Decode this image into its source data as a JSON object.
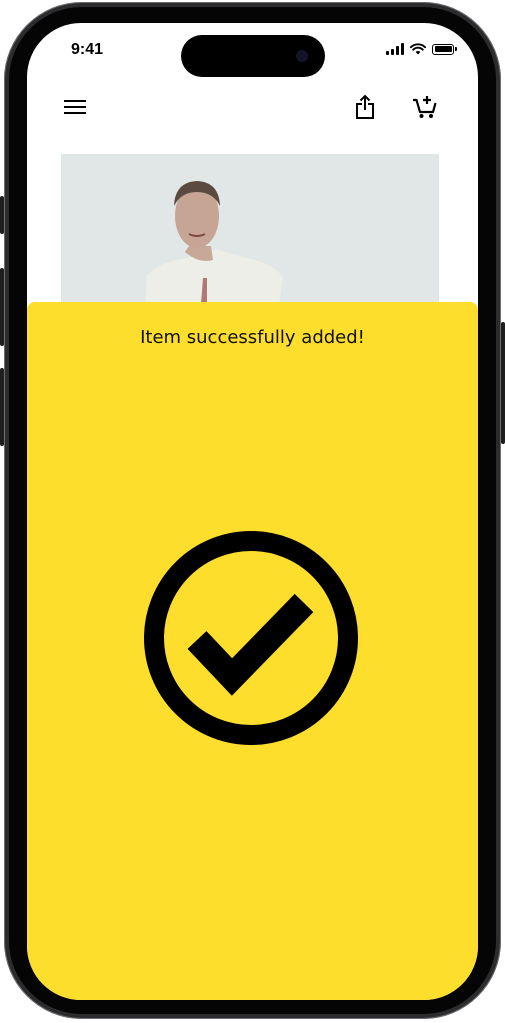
{
  "status_bar": {
    "time": "9:41"
  },
  "nav": {
    "menu_icon": "hamburger-menu-icon",
    "share_icon": "share-icon",
    "cart_icon": "cart-add-icon"
  },
  "product": {
    "image_icon": "product-photo"
  },
  "confirmation": {
    "message": "Item successfully added!",
    "icon": "checkmark-circle-icon",
    "background_color": "#fede2c"
  }
}
